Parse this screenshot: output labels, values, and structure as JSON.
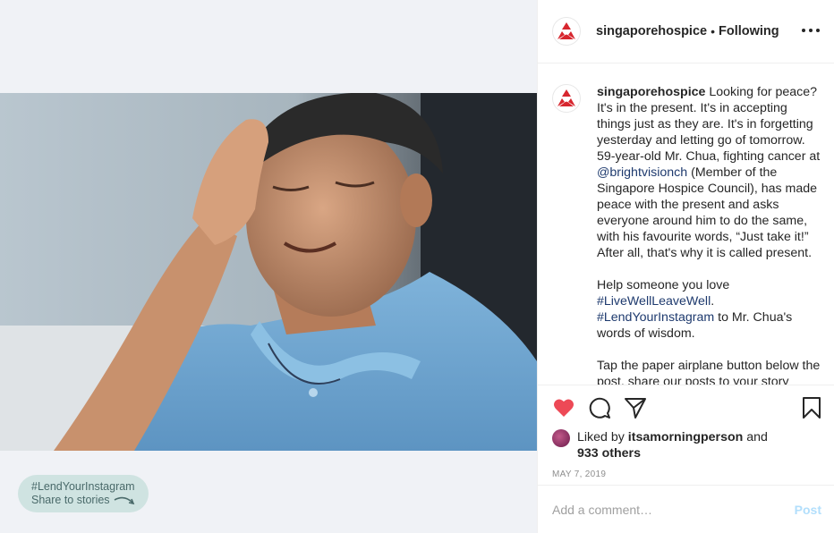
{
  "post": {
    "username": "singaporehospice",
    "follow_status": "Following",
    "separator": "•",
    "caption": {
      "intro": " Looking for peace? It's in the present. It's in accepting things just as they are. It's in forgetting yesterday and letting go of tomorrow. 59-year-old Mr. Chua, fighting cancer at ",
      "mention": "@brightvisionch",
      "middle": " (Member of the Singapore Hospice Council), has made peace with the present and asks everyone around him to do the same, with his favourite words, “Just take it!” After all, that's why it is called present.",
      "para2_start": "Help someone you love ",
      "hashtag1": "#LiveWellLeaveWell",
      "para2_mid": ".",
      "hashtag2": "#LendYourInstagram",
      "para2_end": " to Mr. Chua's words of wisdom.",
      "para3": "Tap the paper airplane button below the post, share our posts to your story"
    },
    "likes": {
      "prefix": "Liked by ",
      "user": "itsamorningperson",
      "joiner": " and",
      "others": "933 others"
    },
    "date": "MAY 7, 2019",
    "comment": {
      "placeholder": "Add a comment…",
      "post_label": "Post"
    }
  },
  "share_pill": {
    "tag": "#LendYourInstagram",
    "sub": "Share to stories"
  },
  "icons": {
    "like": "heart-icon",
    "comment": "comment-icon",
    "share": "paper-plane-icon",
    "save": "bookmark-icon",
    "more": "more-options-icon"
  },
  "colors": {
    "heart": "#ed4956",
    "brand_red": "#d7262e",
    "link": "#1e3a6e",
    "post_disabled": "#b2dffc"
  }
}
